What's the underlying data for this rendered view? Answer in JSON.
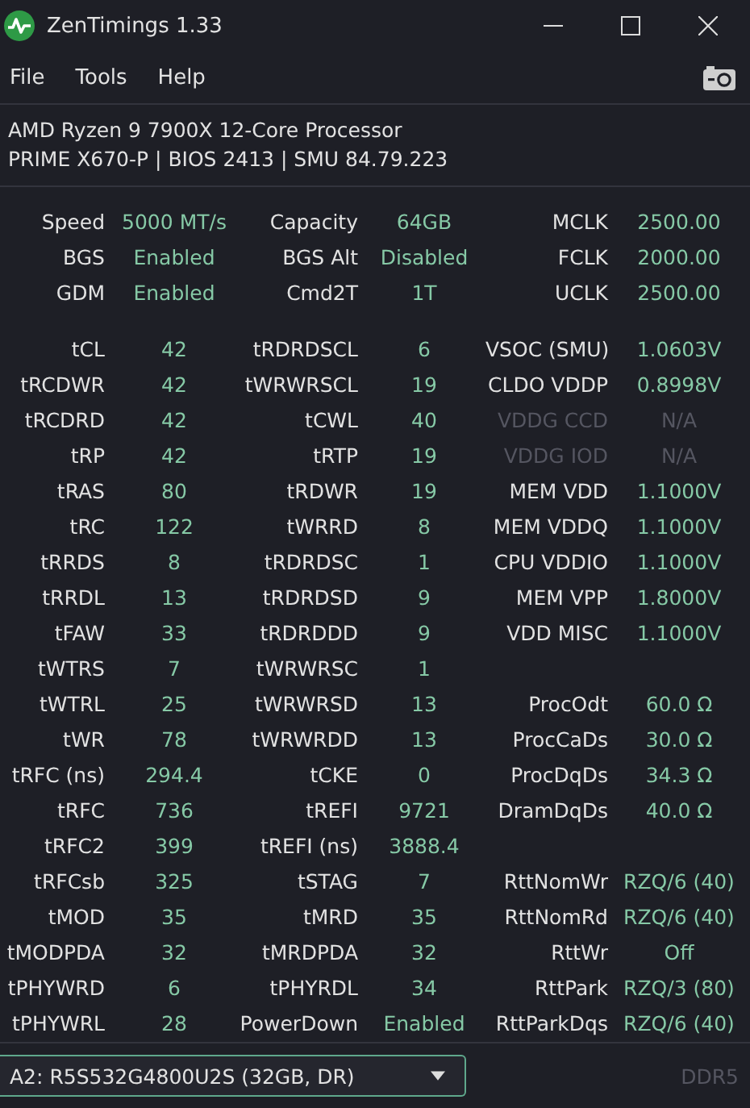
{
  "window": {
    "title": "ZenTimings 1.33"
  },
  "menu": [
    "File",
    "Tools",
    "Help"
  ],
  "system": {
    "cpu": "AMD Ryzen 9 7900X 12-Core Processor",
    "board": "PRIME X670-P | BIOS 2413 | SMU 84.79.223"
  },
  "summary": [
    [
      {
        "label": "Speed",
        "value": "5000 MT/s",
        "disabled": false
      },
      {
        "label": "Capacity",
        "value": "64GB",
        "disabled": false
      },
      {
        "label": "MCLK",
        "value": "2500.00",
        "disabled": false
      }
    ],
    [
      {
        "label": "BGS",
        "value": "Enabled",
        "disabled": false
      },
      {
        "label": "BGS Alt",
        "value": "Disabled",
        "disabled": false
      },
      {
        "label": "FCLK",
        "value": "2000.00",
        "disabled": false
      }
    ],
    [
      {
        "label": "GDM",
        "value": "Enabled",
        "disabled": false
      },
      {
        "label": "Cmd2T",
        "value": "1T",
        "disabled": false
      },
      {
        "label": "UCLK",
        "value": "2500.00",
        "disabled": false
      }
    ]
  ],
  "timings": [
    [
      {
        "label": "tCL",
        "value": "42",
        "disabled": false
      },
      {
        "label": "tRDRDSCL",
        "value": "6",
        "disabled": false
      },
      {
        "label": "VSOC (SMU)",
        "value": "1.0603V",
        "disabled": false
      }
    ],
    [
      {
        "label": "tRCDWR",
        "value": "42",
        "disabled": false
      },
      {
        "label": "tWRWRSCL",
        "value": "19",
        "disabled": false
      },
      {
        "label": "CLDO VDDP",
        "value": "0.8998V",
        "disabled": false
      }
    ],
    [
      {
        "label": "tRCDRD",
        "value": "42",
        "disabled": false
      },
      {
        "label": "tCWL",
        "value": "40",
        "disabled": false
      },
      {
        "label": "VDDG CCD",
        "value": "N/A",
        "disabled": true
      }
    ],
    [
      {
        "label": "tRP",
        "value": "42",
        "disabled": false
      },
      {
        "label": "tRTP",
        "value": "19",
        "disabled": false
      },
      {
        "label": "VDDG IOD",
        "value": "N/A",
        "disabled": true
      }
    ],
    [
      {
        "label": "tRAS",
        "value": "80",
        "disabled": false
      },
      {
        "label": "tRDWR",
        "value": "19",
        "disabled": false
      },
      {
        "label": "MEM VDD",
        "value": "1.1000V",
        "disabled": false
      }
    ],
    [
      {
        "label": "tRC",
        "value": "122",
        "disabled": false
      },
      {
        "label": "tWRRD",
        "value": "8",
        "disabled": false
      },
      {
        "label": "MEM VDDQ",
        "value": "1.1000V",
        "disabled": false
      }
    ],
    [
      {
        "label": "tRRDS",
        "value": "8",
        "disabled": false
      },
      {
        "label": "tRDRDSC",
        "value": "1",
        "disabled": false
      },
      {
        "label": "CPU VDDIO",
        "value": "1.1000V",
        "disabled": false
      }
    ],
    [
      {
        "label": "tRRDL",
        "value": "13",
        "disabled": false
      },
      {
        "label": "tRDRDSD",
        "value": "9",
        "disabled": false
      },
      {
        "label": "MEM VPP",
        "value": "1.8000V",
        "disabled": false
      }
    ],
    [
      {
        "label": "tFAW",
        "value": "33",
        "disabled": false
      },
      {
        "label": "tRDRDDD",
        "value": "9",
        "disabled": false
      },
      {
        "label": "VDD MISC",
        "value": "1.1000V",
        "disabled": false
      }
    ],
    [
      {
        "label": "tWTRS",
        "value": "7",
        "disabled": false
      },
      {
        "label": "tWRWRSC",
        "value": "1",
        "disabled": false
      }
    ],
    [
      {
        "label": "tWTRL",
        "value": "25",
        "disabled": false
      },
      {
        "label": "tWRWRSD",
        "value": "13",
        "disabled": false
      },
      {
        "label": "ProcOdt",
        "value": "60.0 Ω",
        "disabled": false
      }
    ],
    [
      {
        "label": "tWR",
        "value": "78",
        "disabled": false
      },
      {
        "label": "tWRWRDD",
        "value": "13",
        "disabled": false
      },
      {
        "label": "ProcCaDs",
        "value": "30.0 Ω",
        "disabled": false
      }
    ],
    [
      {
        "label": "tRFC (ns)",
        "value": "294.4",
        "disabled": false
      },
      {
        "label": "tCKE",
        "value": "0",
        "disabled": false
      },
      {
        "label": "ProcDqDs",
        "value": "34.3 Ω",
        "disabled": false
      }
    ],
    [
      {
        "label": "tRFC",
        "value": "736",
        "disabled": false
      },
      {
        "label": "tREFI",
        "value": "9721",
        "disabled": false
      },
      {
        "label": "DramDqDs",
        "value": "40.0 Ω",
        "disabled": false
      }
    ],
    [
      {
        "label": "tRFC2",
        "value": "399",
        "disabled": false
      },
      {
        "label": "tREFI (ns)",
        "value": "3888.4",
        "disabled": false
      }
    ],
    [
      {
        "label": "tRFCsb",
        "value": "325",
        "disabled": false
      },
      {
        "label": "tSTAG",
        "value": "7",
        "disabled": false
      },
      {
        "label": "RttNomWr",
        "value": "RZQ/6 (40)",
        "disabled": false
      }
    ],
    [
      {
        "label": "tMOD",
        "value": "35",
        "disabled": false
      },
      {
        "label": "tMRD",
        "value": "35",
        "disabled": false
      },
      {
        "label": "RttNomRd",
        "value": "RZQ/6 (40)",
        "disabled": false
      }
    ],
    [
      {
        "label": "tMODPDA",
        "value": "32",
        "disabled": false
      },
      {
        "label": "tMRDPDA",
        "value": "32",
        "disabled": false
      },
      {
        "label": "RttWr",
        "value": "Off",
        "disabled": false
      }
    ],
    [
      {
        "label": "tPHYWRD",
        "value": "6",
        "disabled": false
      },
      {
        "label": "tPHYRDL",
        "value": "34",
        "disabled": false
      },
      {
        "label": "RttPark",
        "value": "RZQ/3 (80)",
        "disabled": false
      }
    ],
    [
      {
        "label": "tPHYWRL",
        "value": "28",
        "disabled": false
      },
      {
        "label": "PowerDown",
        "value": "Enabled",
        "disabled": false
      },
      {
        "label": "RttParkDqs",
        "value": "RZQ/6 (40)",
        "disabled": false
      }
    ]
  ],
  "footer": {
    "module": "A2: R5S532G4800U2S (32GB, DR)",
    "memory_type": "DDR5"
  }
}
